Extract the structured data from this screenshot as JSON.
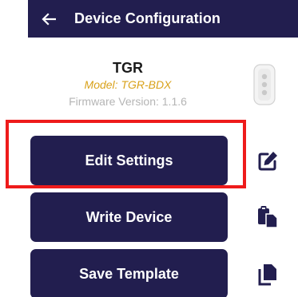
{
  "header": {
    "title": "Device Configuration",
    "back_icon": "arrow-left-icon"
  },
  "device": {
    "name": "TGR",
    "model": "Model: TGR-BDX",
    "firmware": "Firmware Version: 1.1.6",
    "image": "device-remote-image"
  },
  "actions": {
    "edit_label": "Edit Settings",
    "write_label": "Write Device",
    "save_label": "Save Template"
  },
  "side_icons": {
    "edit": "edit-icon",
    "paste": "paste-icon",
    "copy": "copy-icon"
  },
  "colors": {
    "primary": "#221e4f",
    "model_text": "#d9a21b",
    "highlight": "#ee1b1b",
    "firmware_text": "#b5b5b5"
  }
}
